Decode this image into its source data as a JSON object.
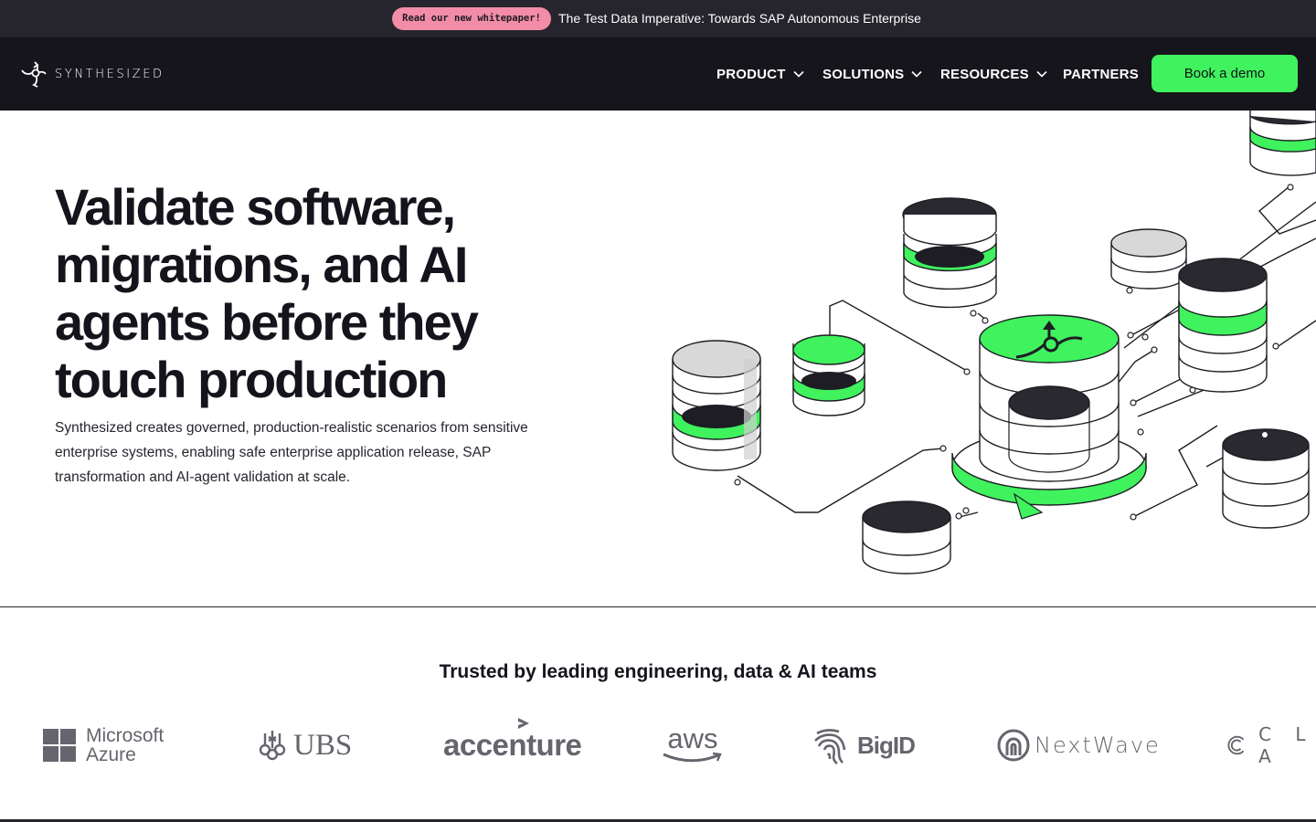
{
  "announcement": {
    "badge": "Read our new whitepaper!",
    "text": "The Test Data Imperative: Towards SAP Autonomous Enterprise"
  },
  "nav": {
    "logo_text": "SYNTHESIZED",
    "items": [
      {
        "label": "PRODUCT",
        "has_dropdown": true
      },
      {
        "label": "SOLUTIONS",
        "has_dropdown": true
      },
      {
        "label": "RESOURCES",
        "has_dropdown": true
      },
      {
        "label": "PARTNERS",
        "has_dropdown": false
      }
    ],
    "cta": "Book a demo"
  },
  "hero": {
    "title": "Validate software, migrations, and AI agents before they touch production",
    "subtitle": "Synthesized creates governed, production-realistic scenarios from sensitive enterprise systems, enabling safe enterprise application release, SAP transformation and AI-agent validation at scale."
  },
  "trusted": {
    "title": "Trusted by leading engineering, data & AI teams",
    "logos": [
      {
        "line1": "Microsoft",
        "line2": "Azure",
        "icon": "windows-grid-icon"
      },
      {
        "name": "UBS",
        "icon": "ubs-keys-icon"
      },
      {
        "name": "accenture",
        "icon": "accenture-chevron-icon"
      },
      {
        "name": "aws",
        "icon": "aws-smile-icon"
      },
      {
        "name": "BigID",
        "icon": "fingerprint-icon"
      },
      {
        "name": "NextWave",
        "icon": "nextwave-spiral-icon"
      },
      {
        "name": "C L A",
        "icon": "cla-rings-icon"
      }
    ]
  },
  "colors": {
    "accent": "#3ff25e",
    "announcement_badge": "#f38ca7",
    "nav_background": "#16151c",
    "announcement_background": "#26252d",
    "text": "#15141c",
    "logo_gray": "#66656d"
  }
}
